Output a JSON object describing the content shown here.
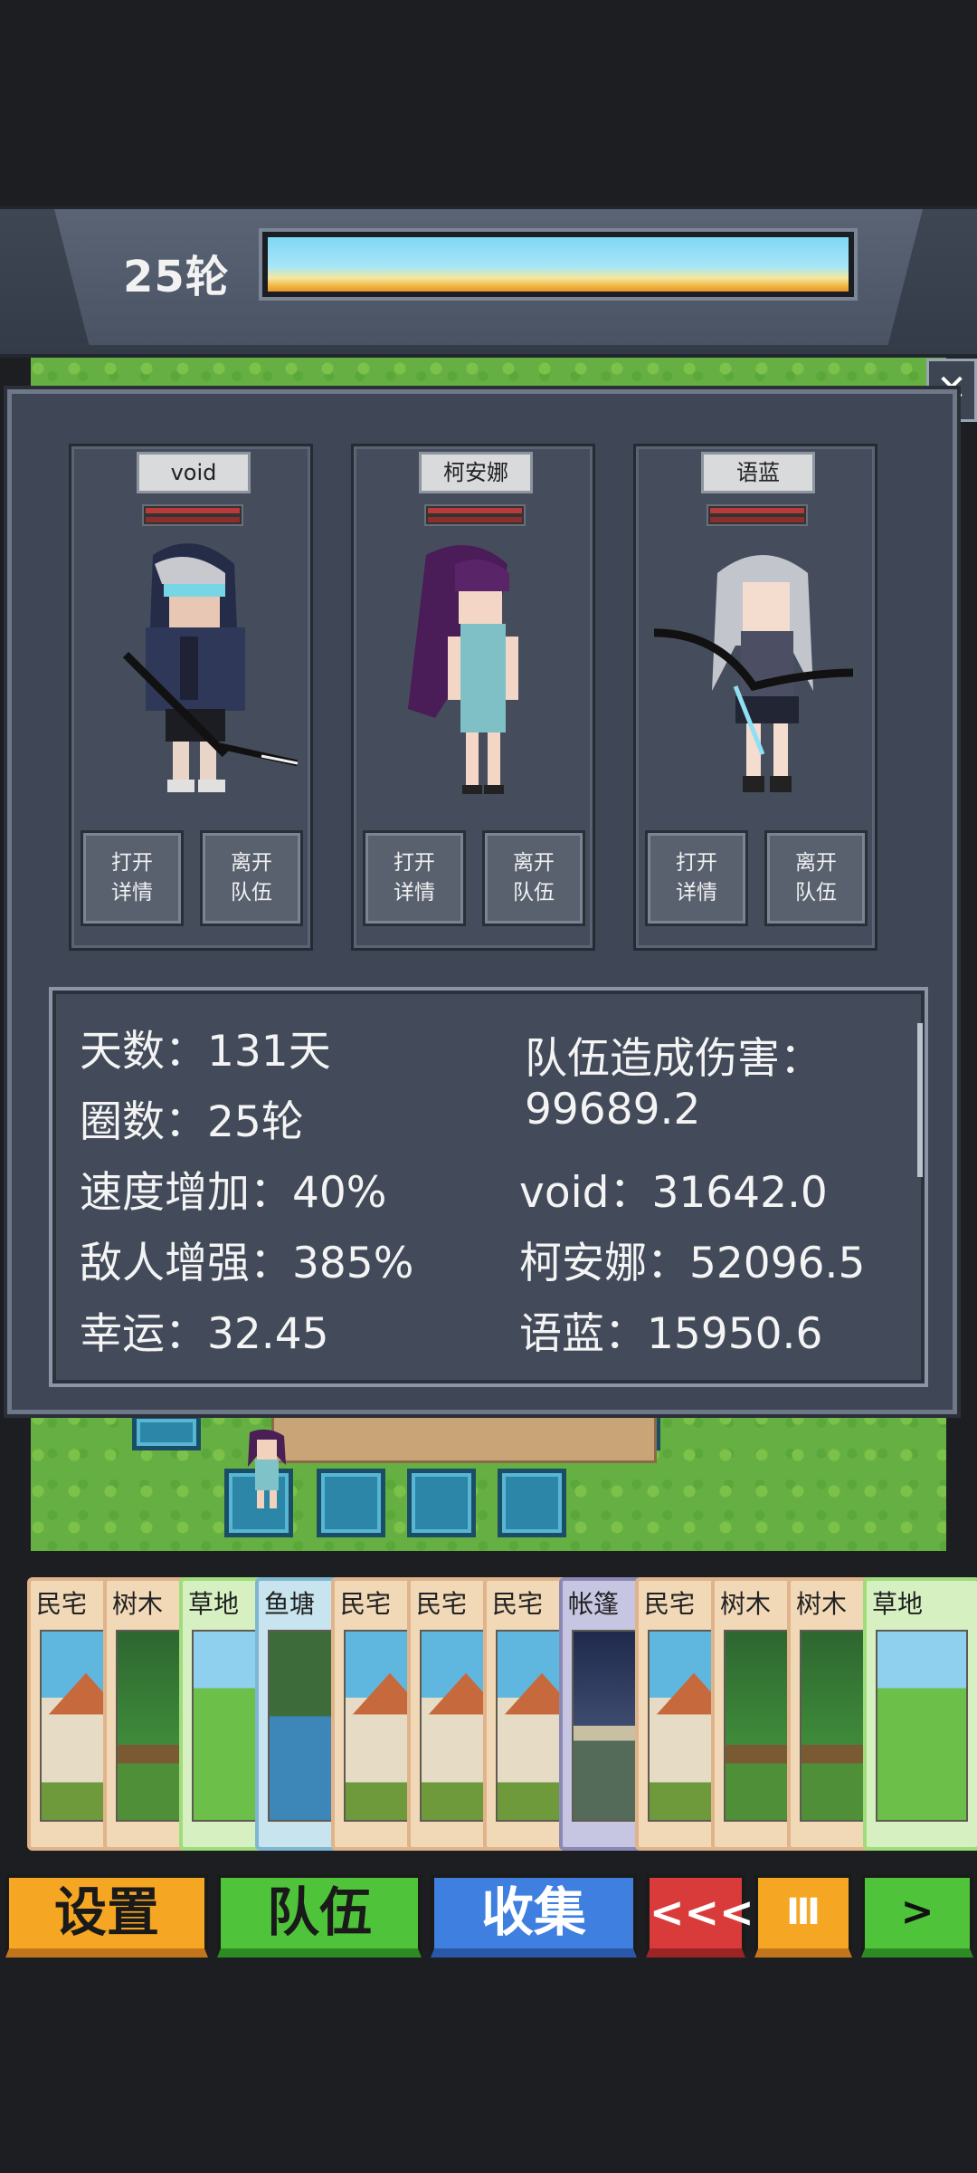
{
  "header": {
    "round_label": "25轮",
    "progress": 1.0,
    "sky_colors": [
      "#7ed7f4",
      "#f0b640"
    ]
  },
  "panel": {
    "close_icon": "close-icon",
    "close_symbol": "✕",
    "characters": [
      {
        "name": "void",
        "open_details": "打开详情",
        "leave_team": "离开队伍"
      },
      {
        "name": "柯安娜",
        "open_details": "打开详情",
        "leave_team": "离开队伍"
      },
      {
        "name": "语蓝",
        "open_details": "打开详情",
        "leave_team": "离开队伍"
      }
    ],
    "button_lines": {
      "open_1": "打开",
      "open_2": "详情",
      "leave_1": "离开",
      "leave_2": "队伍"
    }
  },
  "stats": {
    "days": "天数：131天",
    "rounds": "圈数：25轮",
    "speed": "速度增加：40%",
    "enemy": "敌人增强：385%",
    "luck": "幸运：32.45",
    "team_damage_label": "队伍造成伤害：",
    "team_damage_value": "99689.2",
    "void_damage": "void：31642.0",
    "keanna_damage": "柯安娜：52096.5",
    "yulan_damage": "语蓝：15950.6"
  },
  "hand": [
    {
      "name": "民宅",
      "kind": "house"
    },
    {
      "name": "树木",
      "kind": "tree"
    },
    {
      "name": "草地",
      "kind": "grass"
    },
    {
      "name": "鱼塘",
      "kind": "water"
    },
    {
      "name": "民宅",
      "kind": "house"
    },
    {
      "name": "民宅",
      "kind": "house"
    },
    {
      "name": "民宅",
      "kind": "house"
    },
    {
      "name": "帐篷",
      "kind": "camp"
    },
    {
      "name": "民宅",
      "kind": "house"
    },
    {
      "name": "树木",
      "kind": "tree"
    },
    {
      "name": "树木",
      "kind": "tree"
    },
    {
      "name": "草地",
      "kind": "grass"
    }
  ],
  "toolbar": {
    "settings": "设置",
    "team": "队伍",
    "collect": "收集",
    "rewind_symbol": "<<<",
    "pause_symbol": "Ⅲ",
    "play_symbol": ">"
  },
  "colors": {
    "panel_bg": "#3f4756",
    "settings": "#f5a623",
    "team": "#4fc33a",
    "collect": "#3f7fe0",
    "rewind": "#d93b3b"
  }
}
